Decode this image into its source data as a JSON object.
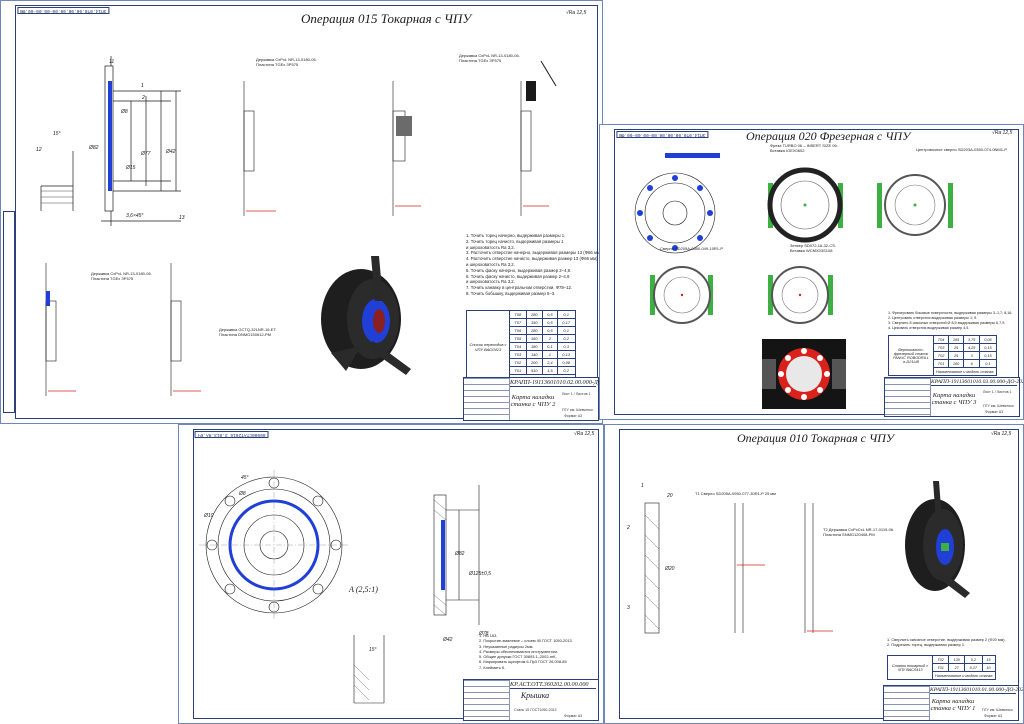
{
  "colors": {
    "frame": "#2b3f7a",
    "highlight": "#1f3fd6",
    "part_red": "#d9221c",
    "fixture_green": "#3cb043",
    "hatch": "#2a2a2a"
  },
  "sheets": {
    "op015": {
      "stamp": "ЭП14.0Т0.00.00.00.00-00.00-00.ФВ",
      "title": "Операция 015 Токарная с ЧПУ",
      "roughness": "√Ra 12,5",
      "tool1": "Державка CxPxL NR-13-0180-06. Пластина TGEx ЗР575",
      "tool2": "Державка CxPxL NR-13-0180-06. Пластина TGEx ЗР575",
      "tool3": "Державка CxPxL NR-13-0180-06. Пластина TGEx ЗР575",
      "tool4": "Державка GCTQ-32LNR-16-ET. Пластина DNMG150612-PM",
      "notes": [
        "1. Точить торец начерно, выдерживая размеры 1.",
        "2. Точить торец начисто, выдерживая размеры 1",
        "и шероховатость Ra 3,2.",
        "3. Расточить отверстие начерно, выдерживая размеры 13 (Ф66 мм).",
        "4. Расточить отверстие начисто, выдерживая размер 13 (Ф66 мм)",
        "и шероховатость Ra 3,2.",
        "5. Точить фаску начерно, выдерживая размер 2–4,9.",
        "6. Точить фаску начисто, выдерживая размер 2–4,9",
        "и шероховатость Ra 3,2.",
        "7. Точить канавку в центральном отверстии, Ф78–12.",
        "8. Точить бобышку, выдерживая размер 5–3."
      ],
      "table_caption": "Список переходов с ЧПУ ВАСЛ413",
      "table_rows": [
        [
          "Т08",
          "280",
          "0,5",
          "0,1"
        ],
        [
          "Т07",
          "150",
          "0,5",
          "0,17"
        ],
        [
          "Т06",
          "280",
          "0,5",
          "0,1"
        ],
        [
          "Т05",
          "160",
          "2",
          "0,2"
        ],
        [
          "Т04",
          "180",
          "0,1",
          "0,3"
        ],
        [
          "Т03",
          "140",
          "1",
          "0,13"
        ],
        [
          "Т02",
          "200",
          "2,4",
          "0,08"
        ],
        [
          "Т01",
          "510",
          "1,5",
          "0,2"
        ]
      ],
      "table_footer": "Наименование и модель станка",
      "doc_code": "КРАПП-19113601010.02.00.000-ДО-2023",
      "doc_name": "Карта наладки станка с ЧПУ 2",
      "sheet_info": "Лист 1 / Листов 1",
      "org": "ПГУ им. Шевченко",
      "format": "Формат А3"
    },
    "op020": {
      "stamp": "ЭП14.0Т0.00.00.00.00-00.00-00.ФВ",
      "title": "Операция 020 Фрезерная с ЧПУ",
      "roughness": "√Ra 12,5",
      "tool_mill": "Фреза TURBO 06 – INSERT SIZE 06. Вставка IOEX0602",
      "tool_center": "Центровочное сверло SD203A-0350-074-0NM1-P",
      "tool_drill": "Сверло SD205A-0850-049-10R1-P",
      "tool_countersink": "Зенкер SD072-16-32-CS. Вставка WCMX03S108",
      "notes": [
        "1. Фрезеровать боковые поверхности, выдерживая размеры 3–1,7; 8,16.",
        "2. Центровать отверстия выдерживая размеры 1; 9.",
        "3. Сверлить 8 сквозных отверстий Ø 8,5 выдерживая размеры 6,7,9.",
        "4. Цековать отверстия выдерживая размер 4,5."
      ],
      "table_caption": "Вертикально-фрезерный станок FANUC ROBODRILL α-D21LiB",
      "table_rows": [
        [
          "Т04",
          "165",
          "3,75",
          "0,06"
        ],
        [
          "Т03",
          "29",
          "4,25",
          "0,15"
        ],
        [
          "Т02",
          "29",
          "3",
          "0,15"
        ],
        [
          "Т01",
          "160",
          "6",
          "0,1"
        ]
      ],
      "table_footer": "Наименование и модель станка",
      "doc_code": "КРАПП-19113601010.03.00.000-ДО-2023",
      "doc_name": "Карта наладки станка с ЧПУ 3",
      "sheet_info": "Лист 1 / Листов 1",
      "org": "ПГУ им. Шевченко",
      "format": "Формат А3"
    },
    "part": {
      "stamp": "00000СТАТ2016 3.013.ЯА.КЧ",
      "roughness": "√Ra 12,5",
      "detail_label": "А (2,5:1)",
      "notes": [
        "1. НВ 163.",
        "2. Покрытие-эмалевое – слоем 40 ГОСТ 1050-2013.",
        "3. Неуказанные радиусы 2мм.",
        "4. Размеры обеспечиваются инструментом.",
        "5. Общие допуски ГОСТ 30893.1–2002-mK.",
        "6. Маркировать шрифтом 6-Пр3 ГОСТ 26.008-85",
        "7. Клеймить К."
      ],
      "doc_code": "КР.АСТ.ОТТ.360202.00.00.000",
      "part_name": "Крышка",
      "material": "Сталь 15 ГОСТ1050-2013",
      "format": "Формат А3"
    },
    "op010": {
      "title": "Операция 010 Токарная с ЧПУ",
      "roughness": "√Ra 12,5",
      "tool1": "Т1 Сверло SD205A-0950-077-30R1-P 25 мм",
      "tool2": "Т2 Державка CxPxCxL NR-17-0119-06. Пластина SNMG120408-PM",
      "notes": [
        "1. Сверлить сквозное отверстие, выдерживая размер 2 (Ф20 мм).",
        "2. Подрезать торец, выдерживая размер 1."
      ],
      "table_caption": "Станок токарный с ЧПУ ВАСЛ413",
      "table_rows": [
        [
          "Т02",
          "130",
          "0,2",
          "15"
        ],
        [
          "Т01",
          "27",
          "0,17",
          "10"
        ]
      ],
      "table_footer": "Наименование и модель станка",
      "doc_code": "КРАПП-19113601010.01.00.000-ДО-2023",
      "doc_name": "Карта наладки станка с ЧПУ 1",
      "org": "ПГУ им. Шевченко",
      "format": "Формат А3"
    }
  }
}
